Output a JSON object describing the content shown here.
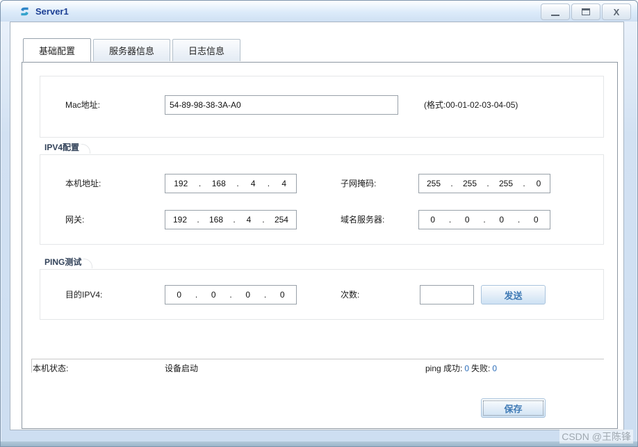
{
  "window": {
    "title": "Server1",
    "close_glyph": "X"
  },
  "tabs": {
    "basic": "基础配置",
    "server_info": "服务器信息",
    "log_info": "日志信息"
  },
  "mac": {
    "label": "Mac地址:",
    "value": "54-89-98-38-3A-A0",
    "format_hint": "(格式:00-01-02-03-04-05)"
  },
  "ip_separator": ".",
  "ipv4": {
    "group_title": "IPV4配置",
    "host": {
      "label": "本机地址:",
      "octets": [
        "192",
        "168",
        "4",
        "4"
      ]
    },
    "mask": {
      "label": "子网掩码:",
      "octets": [
        "255",
        "255",
        "255",
        "0"
      ]
    },
    "gateway": {
      "label": "网关:",
      "octets": [
        "192",
        "168",
        "4",
        "254"
      ]
    },
    "dns": {
      "label": "域名服务器:",
      "octets": [
        "0",
        "0",
        "0",
        "0"
      ]
    }
  },
  "ping": {
    "group_title": "PING测试",
    "dest": {
      "label": "目的IPV4:",
      "octets": [
        "0",
        "0",
        "0",
        "0"
      ]
    },
    "count_label": "次数:",
    "count_value": "",
    "send_label": "发送"
  },
  "status": {
    "label": "本机状态:",
    "value": "设备启动",
    "ping_success_label": "ping 成功:",
    "ping_success_value": "0",
    "ping_fail_label": "失败:",
    "ping_fail_value": "0"
  },
  "save_label": "保存",
  "watermark": "CSDN @王陈锋",
  "colors": {
    "title_text": "#1c3f94",
    "button_text": "#3f7ab5",
    "ping_value": "#2e6fba",
    "watermark": "#9fa8b0"
  }
}
